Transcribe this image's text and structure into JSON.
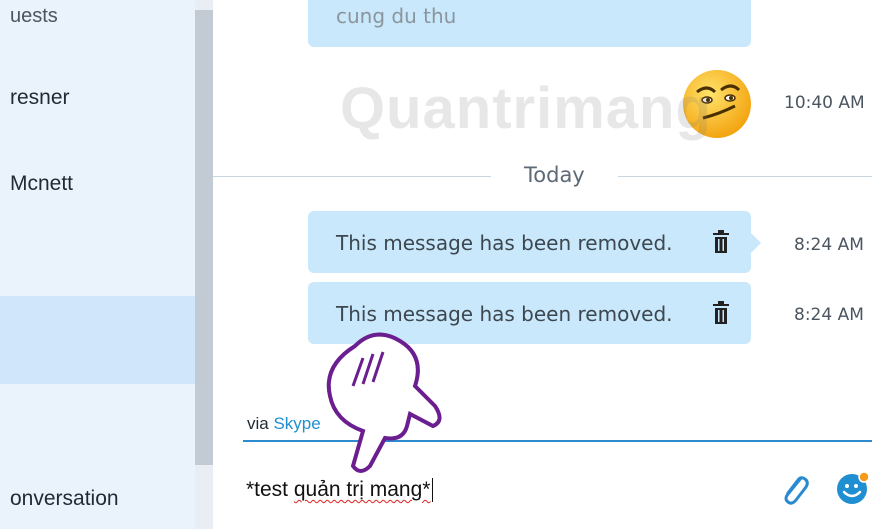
{
  "sidebar": {
    "items": [
      {
        "label": "uests"
      },
      {
        "label": "resner"
      },
      {
        "label": "Mcnett"
      },
      {
        "label": "onversation"
      }
    ]
  },
  "chat": {
    "messages": [
      {
        "text": "cung du thu",
        "time": ""
      },
      {
        "text": "",
        "time": "10:40 AM"
      },
      {
        "text": "This message has been removed.",
        "time": "8:24 AM"
      },
      {
        "text": "This message has been removed.",
        "time": "8:24 AM"
      }
    ],
    "date_separator": "Today",
    "via_prefix": "via",
    "via_link": "Skype"
  },
  "composer": {
    "value_plain": "*test ",
    "value_wavy": "quản trị mang*"
  },
  "watermark": "Quantrimang",
  "icons": {
    "trash": "trash-icon",
    "attach": "paperclip-icon",
    "emoji": "emoticon-icon",
    "emoticon_message": "smirk-emoticon"
  },
  "colors": {
    "bubble": "#c9e8fb",
    "accent": "#2e8bd0",
    "sidebar": "#eaf3fb",
    "sidebar_selected": "#cfe6fb"
  }
}
